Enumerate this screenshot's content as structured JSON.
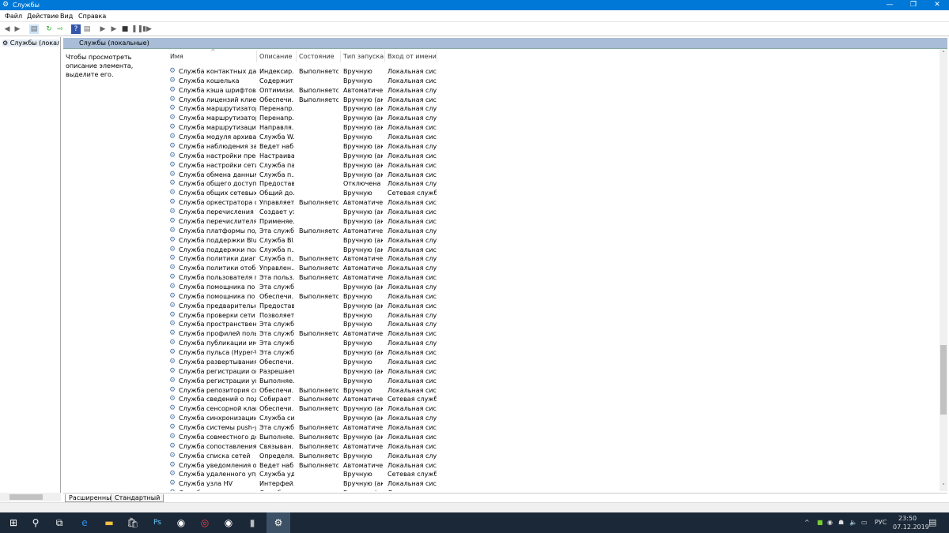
{
  "window": {
    "title": "Службы"
  },
  "menu": [
    "Файл",
    "Действие",
    "Вид",
    "Справка"
  ],
  "left_pane": {
    "tree_item": "Службы (локалы"
  },
  "right_pane": {
    "header": "Службы (локальные)",
    "description": "Чтобы просмотреть описание элемента, выделите его."
  },
  "columns": [
    "Имя",
    "Описание",
    "Состояние",
    "Тип запуска",
    "Вход от имени"
  ],
  "rows": [
    [
      "Служба контактных данн...",
      "Индексир...",
      "Выполняется",
      "Вручную",
      "Локальная сис..."
    ],
    [
      "Служба кошелька",
      "Содержит ...",
      "",
      "Вручную",
      "Локальная сис..."
    ],
    [
      "Служба кэша шрифтов Wi...",
      "Оптимизи...",
      "Выполняется",
      "Автоматиче...",
      "Локальная слу..."
    ],
    [
      "Служба лицензий клиента...",
      "Обеспечи...",
      "Выполняется",
      "Вручную (ак...",
      "Локальная сис..."
    ],
    [
      "Служба маршрутизатора ...",
      "Перенапр...",
      "",
      "Вручную (ак...",
      "Локальная слу..."
    ],
    [
      "Служба маршрутизатора ...",
      "Перенапр...",
      "",
      "Вручную (ак...",
      "Локальная слу..."
    ],
    [
      "Служба маршрутизации р...",
      "Направля...",
      "",
      "Вручную (ак...",
      "Локальная сис..."
    ],
    [
      "Служба модуля архиваци...",
      "Служба W...",
      "",
      "Вручную",
      "Локальная сис..."
    ],
    [
      "Служба наблюдения за да...",
      "Ведет наб...",
      "",
      "Вручную (ак...",
      "Локальная слу..."
    ],
    [
      "Служба настройки преоб...",
      "Настраива...",
      "",
      "Вручную (ак...",
      "Локальная сис..."
    ],
    [
      "Служба настройки сети",
      "Служба па...",
      "",
      "Вручную (ак...",
      "Локальная сис..."
    ],
    [
      "Служба обмена данными ...",
      "Служба п...",
      "",
      "Вручную (ак...",
      "Локальная сис..."
    ],
    [
      "Служба общего доступа к ...",
      "Предостав...",
      "",
      "Отключена",
      "Локальная слу..."
    ],
    [
      "Служба общих сетевых ре...",
      "Общий до...",
      "",
      "Вручную",
      "Сетевая служба"
    ],
    [
      "Служба оркестратора обн...",
      "Управляет...",
      "Выполняется",
      "Автоматиче...",
      "Локальная сис..."
    ],
    [
      "Служба перечисления уст...",
      "Создает уз...",
      "",
      "Вручную (ак...",
      "Локальная сис..."
    ],
    [
      "Служба перечислителя пе...",
      "Применяе...",
      "",
      "Вручную (ак...",
      "Локальная сис..."
    ],
    [
      "Служба платформы подк...",
      "Эта служб...",
      "Выполняется",
      "Автоматиче...",
      "Локальная слу..."
    ],
    [
      "Служба поддержки Blueto...",
      "Служба Bl...",
      "",
      "Вручную (ак...",
      "Локальная слу..."
    ],
    [
      "Служба поддержки польз...",
      "Служба п...",
      "",
      "Вручную (ак...",
      "Локальная сис..."
    ],
    [
      "Служба политики диагнос...",
      "Служба п...",
      "Выполняется",
      "Автоматиче...",
      "Локальная слу..."
    ],
    [
      "Служба политики отобра...",
      "Управлен...",
      "Выполняется",
      "Автоматиче...",
      "Локальная слу..."
    ],
    [
      "Служба пользователя пла...",
      "Эта польз...",
      "Выполняется",
      "Автоматиче...",
      "Локальная сис..."
    ],
    [
      "Служба помощника по ло...",
      "Эта служб...",
      "",
      "Вручную (ак...",
      "Локальная слу..."
    ],
    [
      "Служба помощника по со...",
      "Обеспечи...",
      "Выполняется",
      "Вручную",
      "Локальная сис..."
    ],
    [
      "Служба предварительной ...",
      "Предостав...",
      "",
      "Вручную (ак...",
      "Локальная сис..."
    ],
    [
      "Служба проверки сети Wi...",
      "Позволяет...",
      "",
      "Вручную",
      "Локальная слу..."
    ],
    [
      "Служба пространственны...",
      "Эта служб...",
      "",
      "Вручную",
      "Локальная слу..."
    ],
    [
      "Служба профилей пользо...",
      "Эта служб...",
      "Выполняется",
      "Автоматиче...",
      "Локальная сис..."
    ],
    [
      "Служба публикации имен...",
      "Эта служб...",
      "",
      "Вручную",
      "Локальная слу..."
    ],
    [
      "Служба пульса (Hyper-V)",
      "Эта служб...",
      "",
      "Вручную (ак...",
      "Локальная сис..."
    ],
    [
      "Служба развертывания Ap...",
      "Обеспечи...",
      "",
      "Вручную",
      "Локальная сис..."
    ],
    [
      "Служба регистрации оши...",
      "Разрешает...",
      "",
      "Вручную (ак...",
      "Локальная сис..."
    ],
    [
      "Служба регистрации упра...",
      "Выполняе...",
      "",
      "Вручную",
      "Локальная сис..."
    ],
    [
      "Служба репозитория сост...",
      "Обеспечи...",
      "Выполняется",
      "Вручную",
      "Локальная сис..."
    ],
    [
      "Служба сведений о подкл...",
      "Собирает ...",
      "Выполняется",
      "Автоматиче...",
      "Сетевая служба"
    ],
    [
      "Служба сенсорной клавиа...",
      "Обеспечи...",
      "Выполняется",
      "Вручную (ак...",
      "Локальная сис..."
    ],
    [
      "Служба синхронизации в...",
      "Служба си...",
      "",
      "Вручную (ак...",
      "Локальная слу..."
    ],
    [
      "Служба системы push-уве...",
      "Эта служб...",
      "Выполняется",
      "Автоматиче...",
      "Локальная сис..."
    ],
    [
      "Служба совместного дост...",
      "Выполняе...",
      "Выполняется",
      "Вручную (ак...",
      "Локальная сис..."
    ],
    [
      "Служба сопоставления ус...",
      "Связыван...",
      "Выполняется",
      "Автоматиче...",
      "Локальная сис..."
    ],
    [
      "Служба списка сетей",
      "Определя...",
      "Выполняется",
      "Вручную",
      "Локальная слу..."
    ],
    [
      "Служба уведомления о си...",
      "Ведет наб...",
      "Выполняется",
      "Автоматиче...",
      "Локальная сис..."
    ],
    [
      "Служба удаленного управ...",
      "Служба уд...",
      "",
      "Вручную",
      "Сетевая служба"
    ],
    [
      "Служба узла HV",
      "Интерфей...",
      "",
      "Вручную (ак...",
      "Локальная сис..."
    ],
    [
      "Служба узла поставщика ...",
      "Служба уз...",
      "",
      "Вручную (ак...",
      "Локальная слу..."
    ]
  ],
  "tabs": [
    "Расширенный",
    "Стандартный"
  ],
  "tray": {
    "lang": "РУС",
    "time": "23:50",
    "date": "07.12.2019"
  },
  "colors": {
    "titlebar": "#0078d7",
    "taskbar": "#1b2838",
    "pane_header": "#a9bdd6"
  }
}
